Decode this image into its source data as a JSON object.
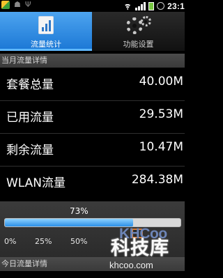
{
  "status_bar": {
    "time": "23:1",
    "icons": [
      "app-icon",
      "android-icon",
      "usb-icon",
      "wifi-icon",
      "signal-icon",
      "battery-icon",
      "alarm-icon"
    ]
  },
  "tabs": [
    {
      "label": "流量统计",
      "icon": "chart-icon",
      "active": true
    },
    {
      "label": "功能设置",
      "icon": "gears-icon",
      "active": false
    }
  ],
  "monthly_section": {
    "header": "当月流量详情",
    "rows": [
      {
        "label": "套餐总量",
        "value": "40.00M"
      },
      {
        "label": "已用流量",
        "value": "29.53M"
      },
      {
        "label": "剩余流量",
        "value": "10.47M"
      },
      {
        "label": "WLAN流量",
        "value": "284.38M"
      }
    ]
  },
  "usage": {
    "percent_label": "73%",
    "percent": 73,
    "ticks": [
      "0%",
      "25%",
      "50%"
    ]
  },
  "daily_section": {
    "header": "今日流量详情"
  },
  "watermark": {
    "logo": "KHCoo",
    "main": "科技库",
    "url": "khcoo.com"
  },
  "colors": {
    "tab_active": "#2a8ae6",
    "progress_fill": "#2b8fe6"
  }
}
